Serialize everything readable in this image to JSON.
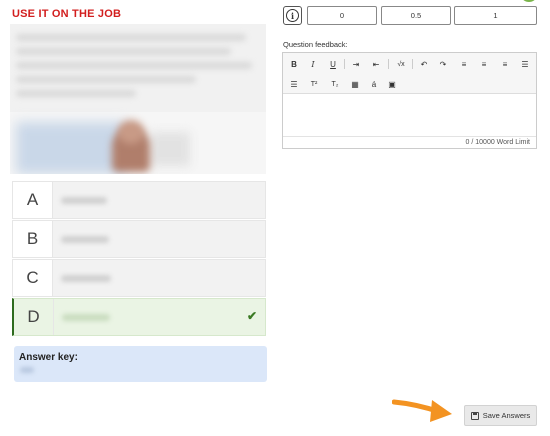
{
  "section_title": "USE IT ON THE JOB",
  "options": [
    {
      "letter": "A",
      "selected": false
    },
    {
      "letter": "B",
      "selected": false
    },
    {
      "letter": "C",
      "selected": false
    },
    {
      "letter": "D",
      "selected": true
    }
  ],
  "answer_key": {
    "label": "Answer key:"
  },
  "scale_values": [
    "0",
    "0.5",
    "1"
  ],
  "feedback": {
    "label": "Question feedback:",
    "word_limit": "0 / 10000 Word Limit",
    "toolbar_row1": [
      {
        "name": "bold-icon",
        "glyph": "B"
      },
      {
        "name": "italic-icon",
        "glyph": "I"
      },
      {
        "name": "underline-icon",
        "glyph": "U"
      },
      {
        "name": "indent-icon",
        "glyph": "⇥"
      },
      {
        "name": "outdent-icon",
        "glyph": "⇤"
      },
      {
        "name": "formula-icon",
        "glyph": "√x"
      },
      {
        "name": "undo-icon",
        "glyph": "↶"
      },
      {
        "name": "redo-icon",
        "glyph": "↷"
      },
      {
        "name": "align-left-icon",
        "glyph": "≡"
      },
      {
        "name": "align-center-icon",
        "glyph": "≡"
      },
      {
        "name": "align-right-icon",
        "glyph": "≡"
      },
      {
        "name": "bulleted-list-icon",
        "glyph": "☰"
      }
    ],
    "toolbar_row2": [
      {
        "name": "numbered-list-icon",
        "glyph": "☰"
      },
      {
        "name": "superscript-icon",
        "glyph": "T²"
      },
      {
        "name": "subscript-icon",
        "glyph": "T₂"
      },
      {
        "name": "table-icon",
        "glyph": "▦"
      },
      {
        "name": "special-character-icon",
        "glyph": "á"
      },
      {
        "name": "image-icon",
        "glyph": "▣"
      }
    ]
  },
  "save_button": {
    "label": "Save Answers",
    "icon": "floppy-disk-icon"
  },
  "colors": {
    "title": "#d21e1e",
    "arrow": "#f39322",
    "selected_option": "#eaf4e4",
    "answer_key_bg": "#dbe7f9",
    "check": "#3b7a24"
  }
}
